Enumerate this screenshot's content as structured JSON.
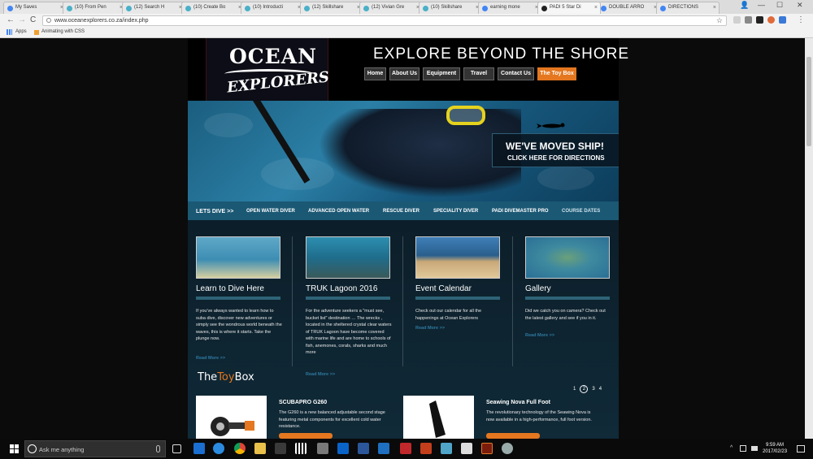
{
  "browser": {
    "tabs": [
      {
        "label": "My Saves",
        "fav": "#4285f4"
      },
      {
        "label": "(10) From Pen",
        "fav": "#4ab0c8"
      },
      {
        "label": "(12) Search H",
        "fav": "#4ab0c8"
      },
      {
        "label": "(10) Create Bo",
        "fav": "#4ab0c8"
      },
      {
        "label": "(10) Introducti",
        "fav": "#4ab0c8"
      },
      {
        "label": "(12) Skillshare",
        "fav": "#4ab0c8"
      },
      {
        "label": "(12) Vivian Gre",
        "fav": "#4ab0c8"
      },
      {
        "label": "(10) Skillshare",
        "fav": "#4ab0c8"
      },
      {
        "label": "earning mone",
        "fav": "#4285f4"
      },
      {
        "label": "PADI 5 Star Di",
        "fav": "#222222"
      },
      {
        "label": "DOUBLE ARRO",
        "fav": "#4285f4"
      },
      {
        "label": "DIRECTIONS",
        "fav": "#4285f4"
      }
    ],
    "tab_close": "×",
    "url": "www.oceanexplorers.co.za/index.php",
    "nav": {
      "back": "←",
      "forward": "→",
      "reload": "C"
    },
    "bookmarks": {
      "apps": "Apps",
      "item1": "Animating with CSS"
    },
    "menu_dots": "⋮",
    "star": "☆",
    "win": {
      "min": "—",
      "max": "☐",
      "close": "✕",
      "user": "👤"
    }
  },
  "site": {
    "logo": {
      "line1": "OCEAN",
      "line2": "EXPLORERS"
    },
    "tagline": "EXPLORE BEYOND THE SHORE",
    "menu": [
      "Home",
      "About Us",
      "Equipment",
      "Travel",
      "Contact Us",
      "The Toy Box"
    ],
    "hero": {
      "line1": "WE'VE MOVED SHIP!",
      "line2": "CLICK HERE FOR DIRECTIONS"
    },
    "subnav": [
      "LETS DIVE >>",
      "OPEN WATER DIVER",
      "ADVANCED OPEN WATER",
      "RESCUE DIVER",
      "SPECIALITY DIVER",
      "PADI DIVEMASTER PRO",
      "COURSE DATES"
    ],
    "columns": [
      {
        "title": "Learn to Dive Here",
        "desc": "If you've always wanted to learn how to suba dive, discover new adventures or simply see the wondrous world beneath the waves, this is where it starts. Take the plunge now.",
        "more": "Read More >>"
      },
      {
        "title": "TRUK Lagoon 2016",
        "desc": "For the adventure seekers a \"must see, bucket list\" destination … The wrecks , located in the sheltered crystal clear waters of TRUK Lagoon have become covered with marine life and are home to schools of fish, anemones, corals, sharks and much more",
        "more": "Read More >>"
      },
      {
        "title": "Event Calendar",
        "desc": "Check out our calendar for all the happenings at Ocean Explorers",
        "more": "Read More >>"
      },
      {
        "title": "Gallery",
        "desc": "Did we catch you on camera? Check out the latest gallery and see if you in it.",
        "more": "Read More >>"
      }
    ],
    "toybox": {
      "a": "The",
      "b": "Toy",
      "c": "Box"
    },
    "pager": {
      "p1": "1",
      "p2": "2",
      "p3": "3",
      "p4": "4"
    },
    "products": [
      {
        "name": "SCUBAPRO G260",
        "desc": "The G260 is a new balanced adjustable second stage featuring metal components for excellent cold water resistance."
      },
      {
        "name": "Seawing Nova Full Foot",
        "desc": "The revolutionary technology of the Seawing Nova is now available in a high-performance, full foot version."
      }
    ]
  },
  "taskbar": {
    "search_placeholder": "Ask me anything",
    "time": "9:59 AM",
    "date": "2017/02/23",
    "tray_caret": "^"
  }
}
